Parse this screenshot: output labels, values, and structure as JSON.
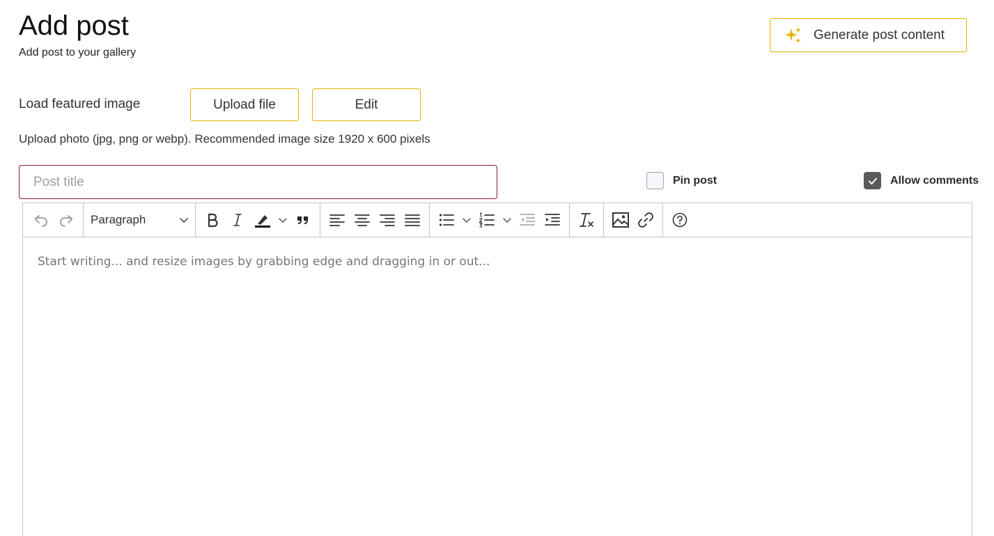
{
  "header": {
    "title": "Add post",
    "subtitle": "Add post to your gallery",
    "generate_label": "Generate post content",
    "accent": "#e6b400"
  },
  "featured": {
    "label": "Load featured image",
    "upload_label": "Upload file",
    "edit_label": "Edit",
    "hint": "Upload photo (jpg, png or webp). Recommended image size 1920 x 600 pixels"
  },
  "post": {
    "title_placeholder": "Post title",
    "title_value": ""
  },
  "options": {
    "pin_label": "Pin post",
    "pin_checked": false,
    "comments_label": "Allow comments",
    "comments_checked": true
  },
  "editor": {
    "paragraph_label": "Paragraph",
    "placeholder": "Start writing... and resize images by grabbing edge and dragging in or out...",
    "toolbar_icons": [
      "undo-icon",
      "redo-icon",
      "bold-icon",
      "italic-icon",
      "highlight-icon",
      "quote-icon",
      "align-left-icon",
      "align-center-icon",
      "align-right-icon",
      "align-justify-icon",
      "bullet-list-icon",
      "numbered-list-icon",
      "outdent-icon",
      "indent-icon",
      "remove-format-icon",
      "image-icon",
      "link-icon",
      "help-icon"
    ]
  }
}
